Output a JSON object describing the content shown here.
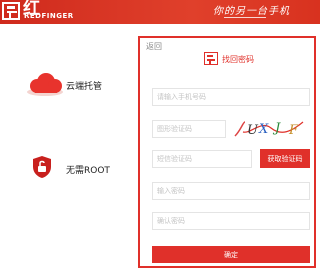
{
  "header": {
    "brand_cn": "红手指",
    "brand_en": "REDFINGER",
    "slogan": "你的另一台手机",
    "logo_icon": "redfinger-logo-icon"
  },
  "features": [
    {
      "label": "云端托管",
      "icon": "cloud-icon"
    },
    {
      "label": "无需ROOT",
      "icon": "shield-unlock-icon"
    }
  ],
  "form": {
    "back_label": "返回",
    "title": "找回密码",
    "title_icon": "reset-password-icon",
    "phone_placeholder": "请输入手机号码",
    "captcha_placeholder": "图形验证码",
    "captcha_image_icon": "captcha-image",
    "sms_placeholder": "短信验证码",
    "sms_button": "获取验证码",
    "password_placeholder": "输入密码",
    "confirm_password_placeholder": "确认密码",
    "confirm_button": "确定"
  },
  "colors": {
    "accent": "#e0302a",
    "header_bg": "#d8321f",
    "cloud": "#e8332d",
    "shield": "#c8201e"
  }
}
